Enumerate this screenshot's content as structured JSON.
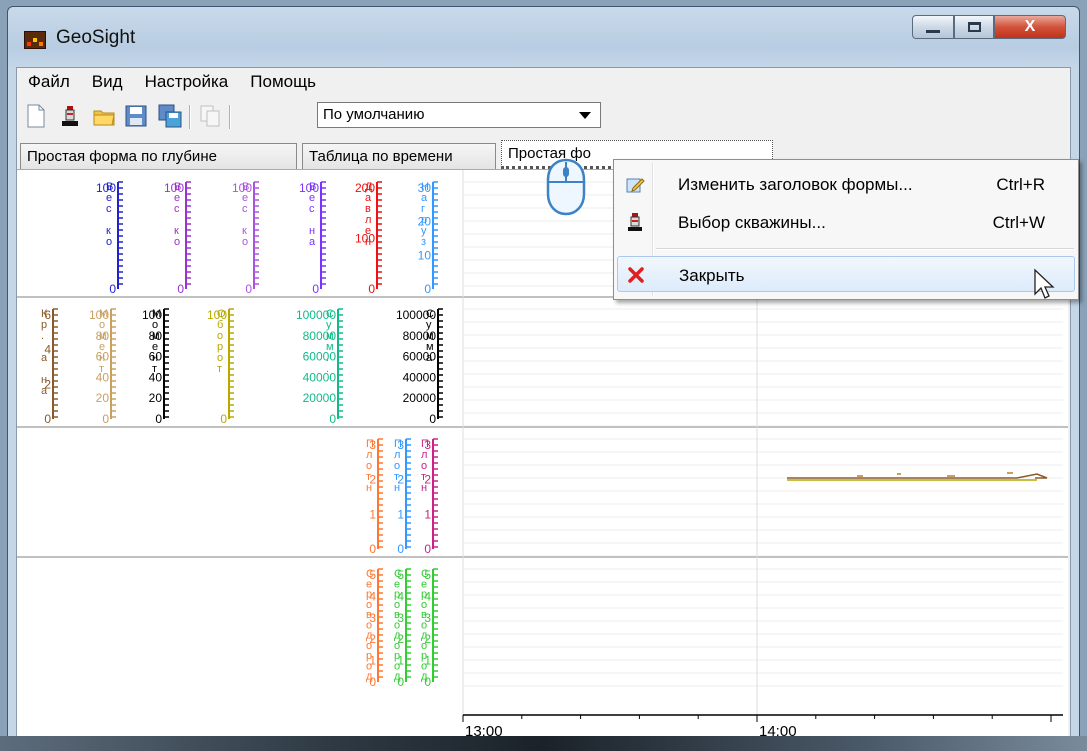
{
  "window": {
    "title": "GeoSight",
    "close_glyph": "X"
  },
  "menubar": [
    "Файл",
    "Вид",
    "Настройка",
    "Помощь"
  ],
  "toolbar": {
    "buttons": [
      "new-icon",
      "well-icon",
      "open-folder-icon",
      "save-icon",
      "save-all-icon",
      "copy-icon"
    ],
    "preset_value": "По умолчанию"
  },
  "tabs": [
    "Простая форма по глубине",
    "Таблица по времени",
    "Простая фо"
  ],
  "context_menu": [
    {
      "label": "Изменить заголовок формы...",
      "shortcut": "Ctrl+R",
      "icon": "edit-title-icon"
    },
    {
      "label": "Выбор скважины...",
      "shortcut": "Ctrl+W",
      "icon": "well-icon"
    },
    {
      "label": "Закрыть",
      "shortcut": "",
      "icon": "close-red-x-icon"
    }
  ],
  "colors": {
    "blue": "#2222cc",
    "purple": "#9933cc",
    "violet": "#7a33ff",
    "red": "#ee1111",
    "sky": "#3399ff",
    "brown": "#8b5a2b",
    "tan": "#c8a060",
    "olive": "#b8a800",
    "teal": "#11bb88",
    "black": "#000000",
    "orange": "#ff7733",
    "pink": "#cc2288",
    "green": "#33cc33"
  },
  "chart_data": {
    "type": "line",
    "panels": [
      {
        "axes": [
          {
            "label": "Вес ко",
            "ticks": [
              "100",
              "0"
            ],
            "color": "#2222cc"
          },
          {
            "label": "Вес ко",
            "ticks": [
              "100",
              "0"
            ],
            "color": "#9933cc"
          },
          {
            "label": "Вес ко",
            "ticks": [
              "100",
              "0"
            ],
            "color": "#aa55dd"
          },
          {
            "label": "Вес на",
            "ticks": [
              "100",
              "0"
            ],
            "color": "#7a33ff"
          },
          {
            "label": "Давлен",
            "ticks": [
              "200",
              "100",
              "0"
            ],
            "color": "#ee1111"
          },
          {
            "label": "Нагруз",
            "ticks": [
              "30",
              "20",
              "10",
              "0"
            ],
            "color": "#3399ff"
          }
        ]
      },
      {
        "axes": [
          {
            "label": "Кр. а на",
            "ticks": [
              "6",
              "4",
              "2",
              "0"
            ],
            "color": "#8b5a2b"
          },
          {
            "label": "Момент",
            "ticks": [
              "100",
              "80",
              "60",
              "40",
              "20",
              "0"
            ],
            "color": "#c8a060"
          },
          {
            "label": "Момент",
            "ticks": [
              "100",
              "80",
              "60",
              "40",
              "20",
              "0"
            ],
            "color": "#000000"
          },
          {
            "label": "Оборот",
            "ticks": [
              "100",
              "0"
            ],
            "color": "#b8a800"
          },
          {
            "label": "Сумм..",
            "ticks": [
              "100000",
              "80000",
              "60000",
              "40000",
              "20000",
              "0"
            ],
            "color": "#11bb88"
          },
          {
            "label": "Сумма",
            "ticks": [
              "100000",
              "80000",
              "60000",
              "40000",
              "20000",
              "0"
            ],
            "color": "#000000"
          }
        ]
      },
      {
        "axes": [
          {
            "label": "Плотн",
            "ticks": [
              "3",
              "2",
              "1",
              "0"
            ],
            "color": "#ff7733"
          },
          {
            "label": "Плотн",
            "ticks": [
              "3",
              "2",
              "1",
              "0"
            ],
            "color": "#3399ff"
          },
          {
            "label": "Плотн",
            "ticks": [
              "3",
              "2",
              "1",
              "0"
            ],
            "color": "#cc2288"
          }
        ]
      },
      {
        "axes": [
          {
            "label": "Сероводород",
            "ticks": [
              "5",
              "4",
              "3",
              "2",
              "1",
              "0"
            ],
            "color": "#ff7733"
          },
          {
            "label": "Сероводород",
            "ticks": [
              "5",
              "4",
              "3",
              "2",
              "1",
              "0"
            ],
            "color": "#33cc33"
          },
          {
            "label": "Сероводород",
            "ticks": [
              "5",
              "4",
              "3",
              "2",
              "1",
              "0"
            ],
            "color": "#33cc33"
          }
        ]
      }
    ],
    "x_ticks": [
      "13:00",
      "14:00"
    ],
    "grid": true
  }
}
